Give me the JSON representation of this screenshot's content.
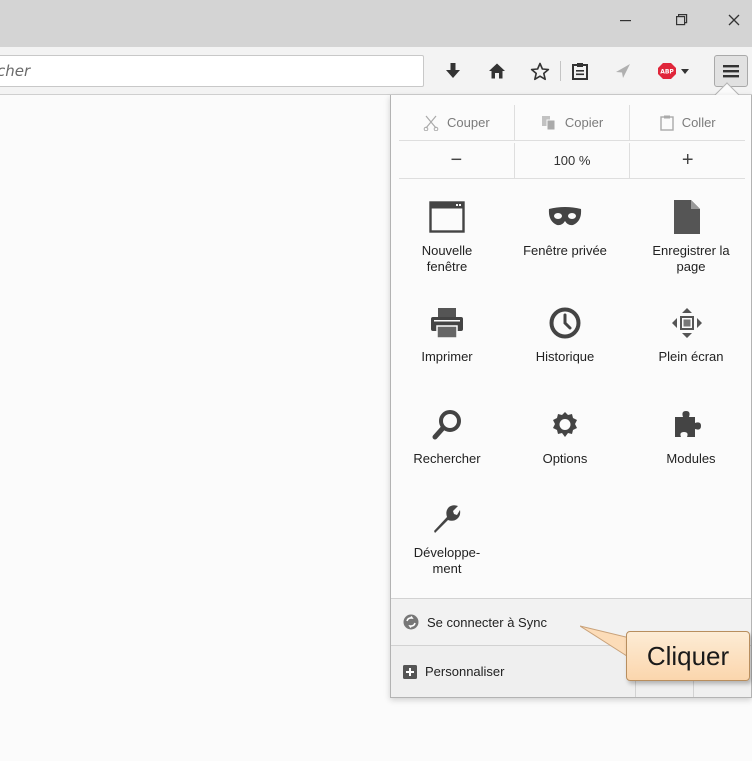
{
  "window": {
    "controls": {
      "minimize": "minimize-icon",
      "maximize": "maximize-icon",
      "close": "close-icon"
    }
  },
  "navbar": {
    "search_value": "cher",
    "icons": [
      "download-icon",
      "home-icon",
      "bookmark-star-icon",
      "reading-list-icon",
      "pocket-send-icon",
      "adblock-icon",
      "hamburger-menu-icon"
    ]
  },
  "menu": {
    "edit": {
      "cut": "Couper",
      "copy": "Copier",
      "paste": "Coller"
    },
    "zoom": {
      "minus": "−",
      "level": "100 %",
      "plus": "+"
    },
    "items": [
      {
        "label": "Nouvelle fenêtre",
        "icon": "new-window-icon"
      },
      {
        "label": "Fenêtre privée",
        "icon": "private-mask-icon"
      },
      {
        "label": "Enregistrer la page",
        "icon": "save-page-icon"
      },
      {
        "label": "Imprimer",
        "icon": "printer-icon"
      },
      {
        "label": "Historique",
        "icon": "history-clock-icon"
      },
      {
        "label": "Plein écran",
        "icon": "fullscreen-icon"
      },
      {
        "label": "Rechercher",
        "icon": "search-icon"
      },
      {
        "label": "Options",
        "icon": "gear-icon"
      },
      {
        "label": "Modules",
        "icon": "puzzle-icon"
      },
      {
        "label": "Développe-\nment",
        "icon": "wrench-icon"
      }
    ],
    "sync_label": "Se connecter à Sync",
    "customize_label": "Personnaliser"
  },
  "callout": {
    "text": "Cliquer"
  },
  "colors": {
    "titlebar": "#d4d4d4",
    "callout_bg": "#fbd6ad",
    "adblock_red": "#e0263a"
  }
}
